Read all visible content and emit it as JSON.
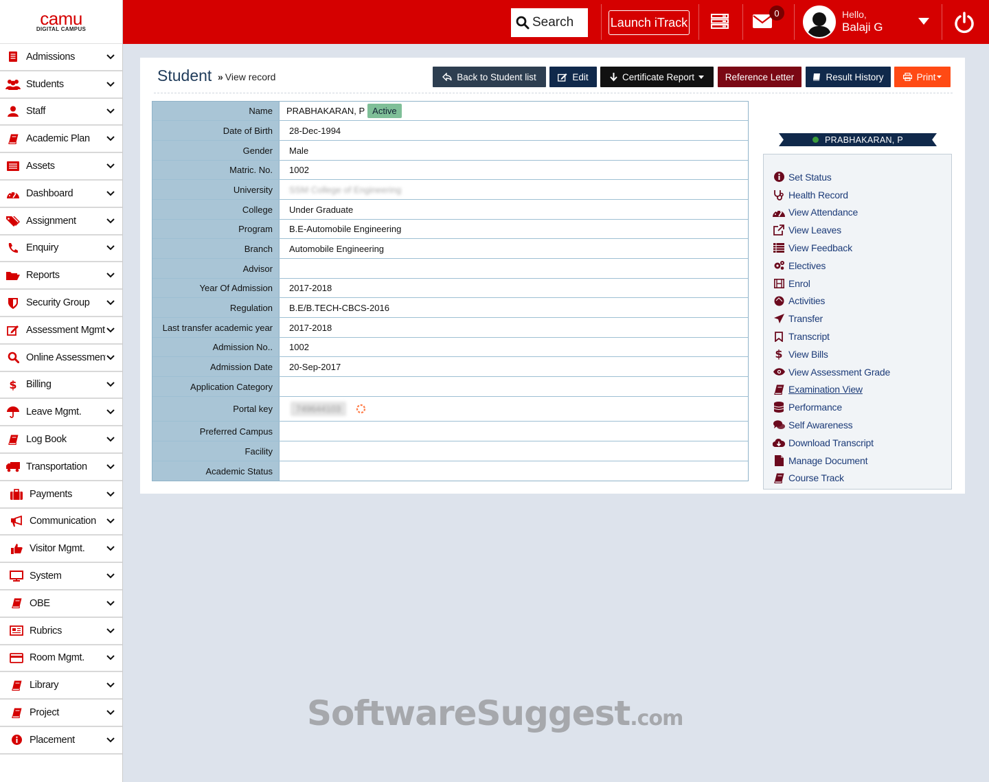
{
  "logo": {
    "main": "camu",
    "sub": "DIGITAL CAMPUS"
  },
  "sidebar": {
    "items": [
      {
        "label": "Admissions",
        "icon": "admissions-icon"
      },
      {
        "label": "Students",
        "icon": "students-icon"
      },
      {
        "label": "Staff",
        "icon": "staff-icon"
      },
      {
        "label": "Academic Plan",
        "icon": "book-icon"
      },
      {
        "label": "Assets",
        "icon": "assets-icon"
      },
      {
        "label": "Dashboard",
        "icon": "dashboard-icon"
      },
      {
        "label": "Assignment",
        "icon": "tag-icon"
      },
      {
        "label": "Enquiry",
        "icon": "phone-icon"
      },
      {
        "label": "Reports",
        "icon": "folder-icon"
      },
      {
        "label": "Security Group",
        "icon": "shield-icon"
      },
      {
        "label": "Assessment Mgmt.",
        "icon": "edit-icon"
      },
      {
        "label": "Online Assessment",
        "icon": "search-icon"
      },
      {
        "label": "Billing",
        "icon": "dollar-icon"
      },
      {
        "label": "Leave Mgmt.",
        "icon": "umbrella-icon"
      },
      {
        "label": "Log Book",
        "icon": "book-icon"
      },
      {
        "label": "Transportation",
        "icon": "truck-icon"
      },
      {
        "label": "Payments",
        "icon": "briefcase-icon"
      },
      {
        "label": "Communication",
        "icon": "megaphone-icon"
      },
      {
        "label": "Visitor Mgmt.",
        "icon": "thumbs-up-icon"
      },
      {
        "label": "System",
        "icon": "monitor-icon"
      },
      {
        "label": "OBE",
        "icon": "book-icon"
      },
      {
        "label": "Rubrics",
        "icon": "newspaper-icon"
      },
      {
        "label": "Room Mgmt.",
        "icon": "card-icon"
      },
      {
        "label": "Library",
        "icon": "book-icon"
      },
      {
        "label": "Project",
        "icon": "book-icon"
      },
      {
        "label": "Placement",
        "icon": "info-icon"
      }
    ]
  },
  "topbar": {
    "search_label": "Search",
    "itrack_label": "Launch iTrack",
    "mail_count": "0",
    "hello": "Hello,",
    "user_name": "Balaji G"
  },
  "page": {
    "title": "Student",
    "subtitle": "View record",
    "buttons": {
      "back": "Back to Student list",
      "edit": "Edit",
      "certificate": "Certificate Report",
      "reference": "Reference Letter",
      "result": "Result History",
      "print": "Print"
    }
  },
  "details": [
    {
      "label": "Name",
      "value": "PRABHAKARAN,  P",
      "badge": "Active"
    },
    {
      "label": "Date of Birth",
      "value": "28-Dec-1994"
    },
    {
      "label": "Gender",
      "value": "Male"
    },
    {
      "label": "Matric. No.",
      "value": "1002"
    },
    {
      "label": "University",
      "value": "SSM College of Engineering",
      "blurred": true
    },
    {
      "label": "College",
      "value": "Under Graduate"
    },
    {
      "label": "Program",
      "value": "B.E-Automobile Engineering"
    },
    {
      "label": "Branch",
      "value": "Automobile Engineering"
    },
    {
      "label": "Advisor",
      "value": ""
    },
    {
      "label": "Year Of Admission",
      "value": "2017-2018"
    },
    {
      "label": "Regulation",
      "value": "B.E/B.TECH-CBCS-2016"
    },
    {
      "label": "Last transfer academic year",
      "value": "2017-2018"
    },
    {
      "label": "Admission No..",
      "value": "1002"
    },
    {
      "label": "Admission Date",
      "value": "20-Sep-2017"
    },
    {
      "label": "Application Category",
      "value": ""
    },
    {
      "label": "Portal key",
      "value": "749644103",
      "blurred": true
    },
    {
      "label": "Preferred Campus",
      "value": ""
    },
    {
      "label": "Facility",
      "value": ""
    },
    {
      "label": "Academic Status",
      "value": ""
    }
  ],
  "profile": {
    "name": "PRABHAKARAN,  P",
    "actions": [
      {
        "label": "Set Status",
        "icon": "info-icon"
      },
      {
        "label": "Health Record",
        "icon": "stethoscope-icon"
      },
      {
        "label": "View Attendance",
        "icon": "dashboard-icon"
      },
      {
        "label": "View Leaves",
        "icon": "external-link-icon"
      },
      {
        "label": "View Feedback",
        "icon": "list-icon"
      },
      {
        "label": "Electives",
        "icon": "gears-icon"
      },
      {
        "label": "Enrol",
        "icon": "film-icon"
      },
      {
        "label": "Activities",
        "icon": "circle-icon"
      },
      {
        "label": "Transfer",
        "icon": "send-icon"
      },
      {
        "label": "Transcript",
        "icon": "bookmark-icon"
      },
      {
        "label": "View Bills",
        "icon": "dollar-icon"
      },
      {
        "label": "View Assessment Grade",
        "icon": "eye-icon"
      },
      {
        "label": "Examination View",
        "icon": "book-icon",
        "underline": true
      },
      {
        "label": "Performance",
        "icon": "database-icon"
      },
      {
        "label": "Self Awareness",
        "icon": "comments-icon"
      },
      {
        "label": "Download Transcript",
        "icon": "cloud-download-icon"
      },
      {
        "label": "Manage Document",
        "icon": "file-icon"
      },
      {
        "label": "Course Track",
        "icon": "book-icon"
      }
    ]
  },
  "watermark": {
    "main": "SoftwareSuggest",
    "suffix": ".com"
  },
  "colors": {
    "brand_red": "#d50000",
    "navy": "#10294b",
    "label_bg": "#a9c5d6",
    "link": "#1c3b78",
    "icon_maroon": "#6b0a1e"
  }
}
